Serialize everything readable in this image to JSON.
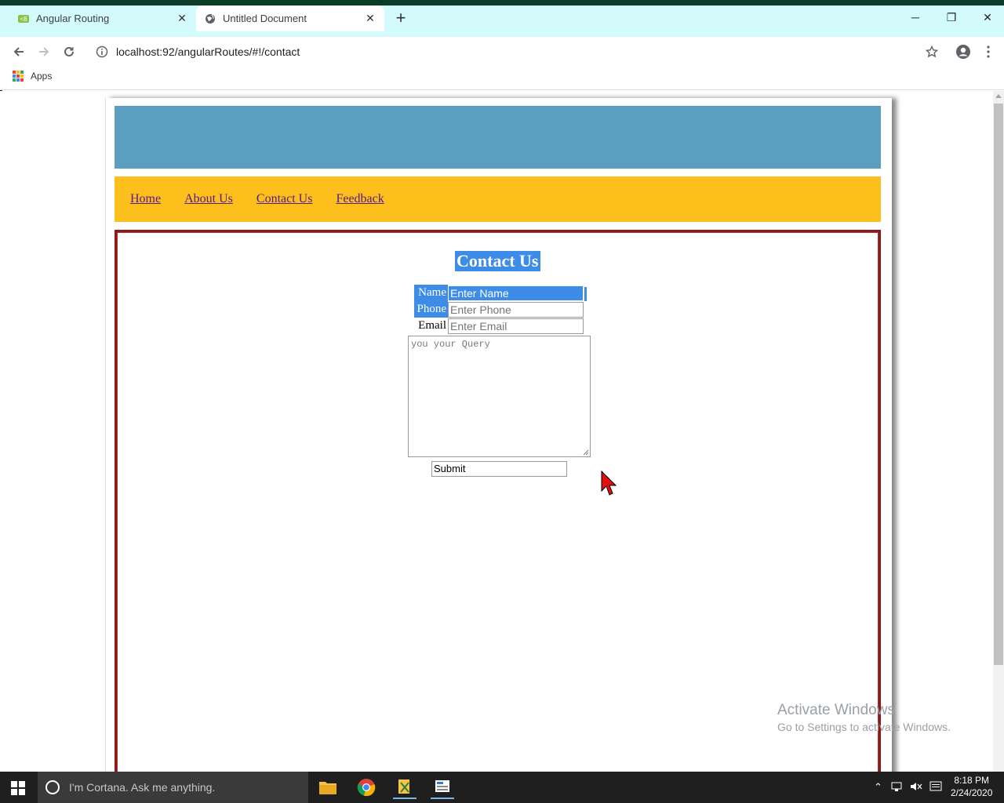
{
  "browser": {
    "tabs": [
      {
        "title": "Angular Routing",
        "icon": "angular-favicon-icon",
        "active": false
      },
      {
        "title": "Untitled Document",
        "icon": "globe-icon",
        "active": true
      }
    ],
    "new_tab_label": "+",
    "url": "localhost:92/angularRoutes/#!/contact",
    "bookmarks": {
      "apps_label": "Apps"
    },
    "window_controls": {
      "minimize": "─",
      "restore": "❐",
      "close": "✕"
    }
  },
  "page": {
    "nav": {
      "items": [
        "Home",
        "About Us",
        "Contact Us",
        "Feedback"
      ],
      "link_color": "#551a8b"
    },
    "header_color": "#5b9ebf",
    "menu_color": "#fdbf1c",
    "content_border_color": "#8b1a1a",
    "contact": {
      "title": "Contact Us",
      "fields": [
        {
          "label": "Name",
          "placeholder": "Enter Name",
          "selected": true
        },
        {
          "label": "Phone",
          "placeholder": "Enter Phone",
          "selected": true
        },
        {
          "label": "Email",
          "placeholder": "Enter Email",
          "selected": false
        }
      ],
      "query_placeholder": "you your Query",
      "submit_label": "Submit"
    },
    "selection_color": "#3d8ce8"
  },
  "watermark": {
    "line1": "Activate Windows",
    "line2": "Go to Settings to activate Windows."
  },
  "taskbar": {
    "cortana_placeholder": "I'm Cortana. Ask me anything.",
    "time": "8:18 PM",
    "date": "2/24/2020"
  }
}
